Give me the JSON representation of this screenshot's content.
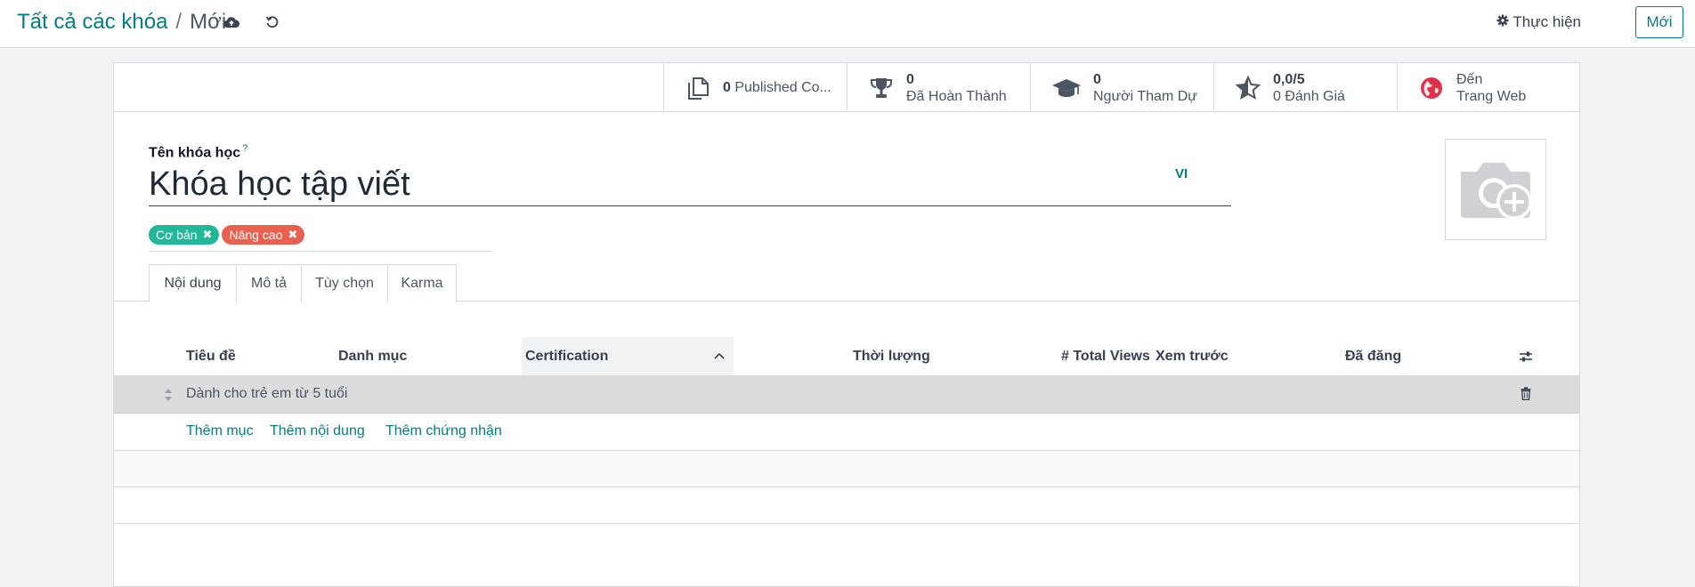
{
  "breadcrumb": {
    "parent": "Tất cả các khóa",
    "separator": "/",
    "current": "Mới"
  },
  "toolbar": {
    "save_icon": "cloud-upload-icon",
    "discard_icon": "undo-icon",
    "actions_label": "Thực hiện",
    "new_label": "Mới"
  },
  "smart_buttons": {
    "contents": {
      "value": "0",
      "label": "Published Co..."
    },
    "completed": {
      "value": "0",
      "label": "Đã Hoàn Thành"
    },
    "attendees": {
      "value": "0",
      "label": "Người Tham Dự"
    },
    "rating": {
      "value": "0,0/5",
      "label": "0 Đánh Giá"
    },
    "website": {
      "line1": "Đến",
      "line2": "Trang Web"
    }
  },
  "form": {
    "name_label": "Tên khóa học",
    "name_help": "?",
    "name_value": "Khóa học tập viết",
    "lang": "VI",
    "tags": [
      {
        "label": "Cơ bản",
        "color": "#21b799"
      },
      {
        "label": "Nâng cao",
        "color": "#e9604e"
      }
    ]
  },
  "tabs": [
    "Nội dung",
    "Mô tả",
    "Tùy chọn",
    "Karma"
  ],
  "list": {
    "columns": [
      "Tiêu đề",
      "Danh mục",
      "Certification",
      "Thời lượng",
      "# Total Views",
      "Xem trước",
      "Đã đăng"
    ],
    "section_row": "Dành cho trẻ em từ 5 tuổi",
    "add_links": [
      "Thêm mục",
      "Thêm nội dung",
      "Thêm chứng nhận"
    ]
  },
  "colors": {
    "accent": "#017e84"
  }
}
